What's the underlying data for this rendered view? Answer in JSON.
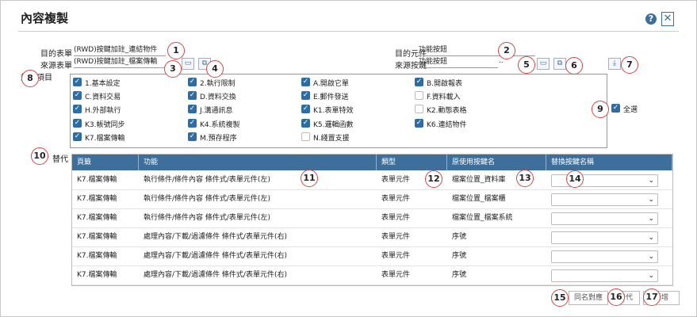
{
  "window": {
    "title": "內容複製",
    "help_icon": "?",
    "close_icon": "✕"
  },
  "form": {
    "target_form_label": "目的表單",
    "target_form_value": "(RWD)按鍵加註_連結物件",
    "source_form_label": "來源表單",
    "source_form_value": "(RWD)按鍵加註_檔案傳輸",
    "target_component_label": "目的元件",
    "target_component_value": "功能按鈕",
    "source_button_label": "來源按鍵",
    "source_button_value": "功能按鈕",
    "source_button_ellipsis": "..",
    "items_label": "規格項目",
    "replace_label": "替代",
    "select_all_label": "全選"
  },
  "icons": {
    "folder": "▭",
    "copy": "⧉",
    "download": "⤓",
    "check": "✓",
    "chevron": "⌄"
  },
  "checkboxes": [
    {
      "label": "1.基本設定",
      "checked": true
    },
    {
      "label": "2.執行限制",
      "checked": true
    },
    {
      "label": "A.開啟它單",
      "checked": true
    },
    {
      "label": "B.開啟報表",
      "checked": true
    },
    {
      "label": "C.資料交易",
      "checked": true
    },
    {
      "label": "D.資料交換",
      "checked": true
    },
    {
      "label": "E.郵件發送",
      "checked": true
    },
    {
      "label": "F.資料載入",
      "checked": false
    },
    {
      "label": "H.外部執行",
      "checked": true
    },
    {
      "label": "J.溝通訊息",
      "checked": true
    },
    {
      "label": "K1.表單特效",
      "checked": true
    },
    {
      "label": "K2.動態表格",
      "checked": false
    },
    {
      "label": "K3.帳號同步",
      "checked": true
    },
    {
      "label": "K4.系統複製",
      "checked": true
    },
    {
      "label": "K5.邏輯函數",
      "checked": true
    },
    {
      "label": "K6.連結物件",
      "checked": true
    },
    {
      "label": "K7.檔案傳輸",
      "checked": true
    },
    {
      "label": "M.預存程序",
      "checked": true
    },
    {
      "label": "N.綫置支援",
      "checked": false
    }
  ],
  "table": {
    "headers": [
      "頁籤",
      "功能",
      "類型",
      "原使用按鍵名",
      "替換按鍵名稱"
    ],
    "rows": [
      [
        "K7.檔案傳輸",
        "執行條件/條件內容 條件式/表單元件(左)",
        "表單元件",
        "檔案位置_資料庫"
      ],
      [
        "K7.檔案傳輸",
        "執行條件/條件內容 條件式/表單元件(左)",
        "表單元件",
        "檔案位置_檔案櫃"
      ],
      [
        "K7.檔案傳輸",
        "執行條件/條件內容 條件式/表單元件(左)",
        "表單元件",
        "檔案位置_檔案系統"
      ],
      [
        "K7.檔案傳輸",
        "處理內容/下載/過濾條件 條件式/表單元件(右)",
        "表單元件",
        "序號"
      ],
      [
        "K7.檔案傳輸",
        "處理內容/下載/過濾條件 條件式/表單元件(右)",
        "表單元件",
        "序號"
      ],
      [
        "K7.檔案傳輸",
        "處理內容/下載/過濾條件 條件式/表單元件(右)",
        "表單元件",
        "序號"
      ]
    ]
  },
  "buttons": {
    "same_name_label": "同名對應",
    "replace_label": "替代",
    "add_label": "新增"
  },
  "badges": [
    "1",
    "2",
    "3",
    "4",
    "5",
    "6",
    "7",
    "8",
    "9",
    "10",
    "11",
    "12",
    "13",
    "14",
    "15",
    "16",
    "17"
  ]
}
